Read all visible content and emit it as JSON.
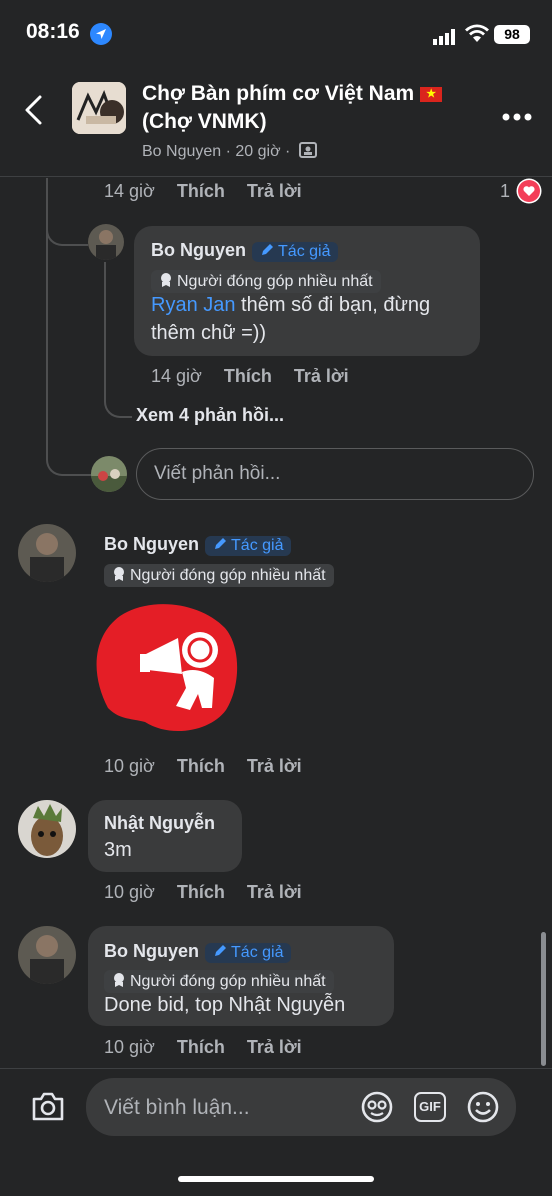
{
  "status": {
    "time": "08:16",
    "battery": "98"
  },
  "header": {
    "title": "Chợ Bàn phím cơ Việt Nam",
    "title2": "(Chợ VNMK)",
    "subtitle": "Bo Nguyen · 20 giờ ·"
  },
  "top_meta": {
    "time": "14 giờ",
    "like": "Thích",
    "reply": "Trả lời",
    "reactions": "1"
  },
  "reply1": {
    "name": "Bo Nguyen",
    "author_badge": "Tác giả",
    "contrib_badge": "Người đóng góp nhiều nhất",
    "mention": "Ryan Jan",
    "text_line1": " thêm số đi bạn, đừng",
    "text_line2": "thêm chữ =))",
    "time": "14 giờ",
    "like": "Thích",
    "reply": "Trả lời"
  },
  "view_replies": "Xem 4 phản hồi...",
  "reply_input": {
    "placeholder": "Viết phản hồi..."
  },
  "comment2": {
    "name": "Bo Nguyen",
    "author_badge": "Tác giả",
    "contrib_badge": "Người đóng góp nhiều nhất",
    "time": "10 giờ",
    "like": "Thích",
    "reply": "Trả lời"
  },
  "comment3": {
    "name": "Nhật Nguyễn",
    "text": "3m",
    "time": "10 giờ",
    "like": "Thích",
    "reply": "Trả lời"
  },
  "comment4": {
    "name": "Bo Nguyen",
    "author_badge": "Tác giả",
    "contrib_badge": "Người đóng góp nhiều nhất",
    "text": "Done bid, top Nhật Nguyễn",
    "time": "10 giờ",
    "like": "Thích",
    "reply": "Trả lời"
  },
  "composer": {
    "placeholder": "Viết bình luận...",
    "gif": "GIF"
  },
  "colors": {
    "accent": "#4599ff",
    "heart": "#f33e58",
    "sticker_red": "#e41e26"
  }
}
